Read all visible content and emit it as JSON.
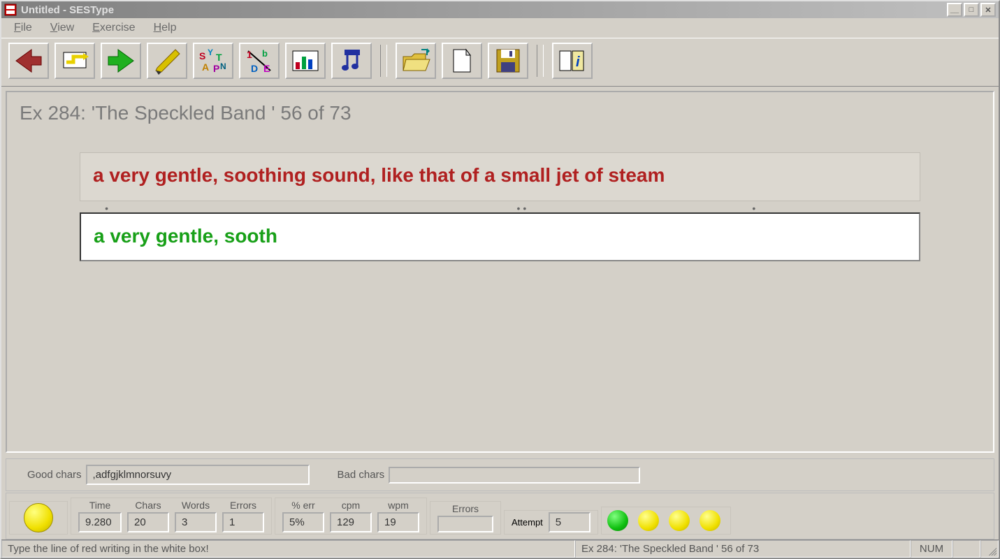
{
  "window": {
    "title": "Untitled - SESType"
  },
  "menu": {
    "file": "File",
    "view": "View",
    "exercise": "Exercise",
    "help": "Help"
  },
  "toolbar": {
    "back": "Previous exercise",
    "repeat": "Repeat line",
    "next": "Next exercise",
    "pen": "Edit exercise",
    "letters": "Random letters",
    "chars": "Random characters",
    "chart": "Statistics chart",
    "music": "Sound settings",
    "open": "Open file",
    "new": "New file",
    "save": "Save file",
    "info": "About"
  },
  "exercise": {
    "header": "Ex 284: 'The Speckled Band ' 56 of 73",
    "prompt": "a very gentle, soothing sound, like that of a small jet of steam",
    "typed": "a very gentle, sooth"
  },
  "chars": {
    "good_label": "Good chars",
    "good_value": ",adfgjklmnorsuvy",
    "bad_label": "Bad chars",
    "bad_value": ""
  },
  "stats": {
    "time": {
      "label": "Time",
      "value": "9.280"
    },
    "chars": {
      "label": "Chars",
      "value": "20"
    },
    "words": {
      "label": "Words",
      "value": "3"
    },
    "errors": {
      "label": "Errors",
      "value": "1"
    },
    "pcterr": {
      "label": "% err",
      "value": "5%"
    },
    "cpm": {
      "label": "cpm",
      "value": "129"
    },
    "wpm": {
      "label": "wpm",
      "value": "19"
    },
    "errors2": {
      "label": "Errors",
      "value": ""
    },
    "attempt": {
      "label": "Attempt",
      "value": "5"
    }
  },
  "status": {
    "hint": "Type the line of red writing in the white box!",
    "exercise": "Ex 284: 'The Speckled Band ' 56 of 73",
    "num": "NUM"
  }
}
